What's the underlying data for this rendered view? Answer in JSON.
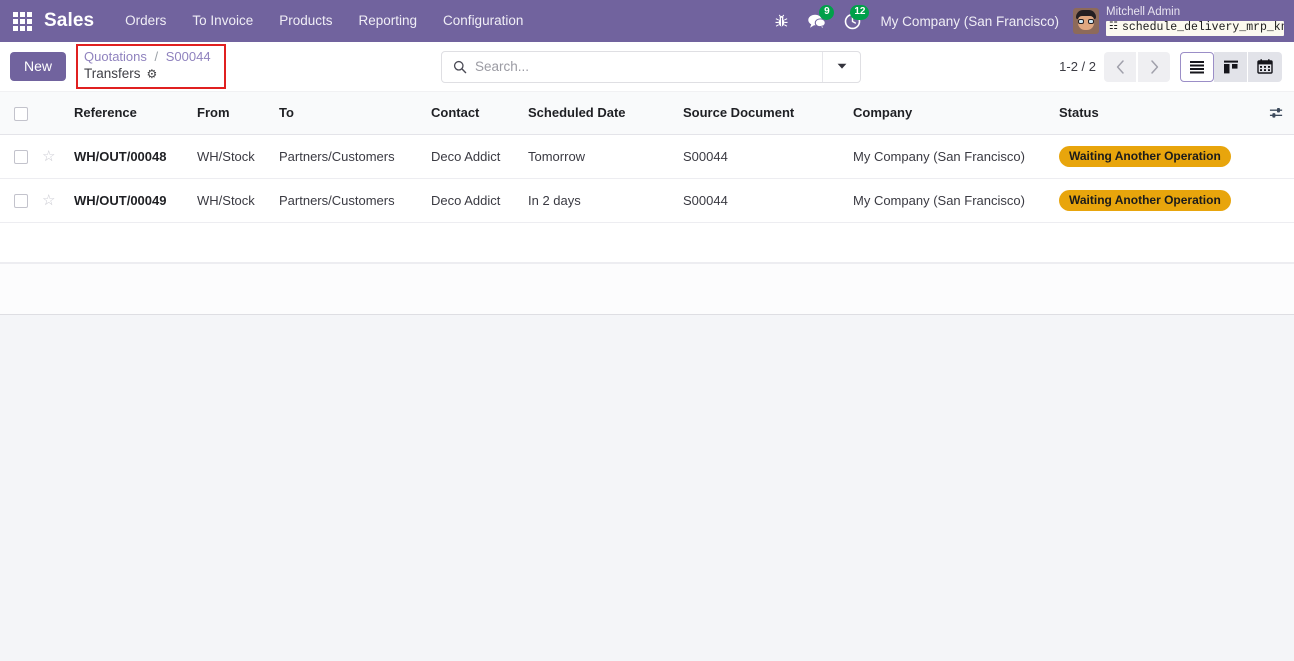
{
  "navbar": {
    "apps_icon": "apps-grid-icon",
    "brand": "Sales",
    "menu": [
      {
        "label": "Orders"
      },
      {
        "label": "To Invoice"
      },
      {
        "label": "Products"
      },
      {
        "label": "Reporting"
      },
      {
        "label": "Configuration"
      }
    ],
    "icons": [
      {
        "name": "bug-icon",
        "glyph": "🐞",
        "badge": null
      },
      {
        "name": "messages-icon",
        "glyph": "💬",
        "badge": "9"
      },
      {
        "name": "activities-clock-icon",
        "glyph": "◔",
        "badge": "12"
      }
    ],
    "company": "My Company (San Francisco)",
    "user_name": "Mitchell Admin",
    "database": "schedule_delivery_mrp_kn…",
    "database_icon": "database-icon"
  },
  "control_panel": {
    "new_button": "New",
    "breadcrumb": {
      "parent": "Quotations",
      "separator": "/",
      "record": "S00044",
      "current": "Transfers",
      "settings_icon": "gear-icon"
    },
    "search": {
      "placeholder": "Search...",
      "value": "",
      "icon": "search-icon",
      "toggle_icon": "chevron-down-icon"
    },
    "pager": {
      "label": "1-2 / 2",
      "prev_icon": "chevron-left-icon",
      "next_icon": "chevron-right-icon"
    },
    "view_switcher": [
      {
        "name": "list-view-button",
        "icon": "list-icon",
        "active": true
      },
      {
        "name": "kanban-view-button",
        "icon": "kanban-icon",
        "active": false
      },
      {
        "name": "calendar-view-button",
        "icon": "calendar-icon",
        "active": false
      }
    ]
  },
  "list": {
    "columns": [
      "Reference",
      "From",
      "To",
      "Contact",
      "Scheduled Date",
      "Source Document",
      "Company",
      "Status"
    ],
    "optional_columns_icon": "sliders-icon",
    "rows": [
      {
        "reference": "WH/OUT/00048",
        "from": "WH/Stock",
        "to": "Partners/Customers",
        "contact": "Deco Addict",
        "scheduled_date": "Tomorrow",
        "source_document": "S00044",
        "company": "My Company (San Francisco)",
        "status": "Waiting Another Operation"
      },
      {
        "reference": "WH/OUT/00049",
        "from": "WH/Stock",
        "to": "Partners/Customers",
        "contact": "Deco Addict",
        "scheduled_date": "In 2 days",
        "source_document": "S00044",
        "company": "My Company (San Francisco)",
        "status": "Waiting Another Operation"
      }
    ]
  },
  "colors": {
    "navbar": "#71639E",
    "primary": "#71639E",
    "status_badge": "#E8A50C",
    "highlight_outline": "#E02020",
    "badge_count": "#00A04A",
    "page_background": "#F4F5F8"
  }
}
